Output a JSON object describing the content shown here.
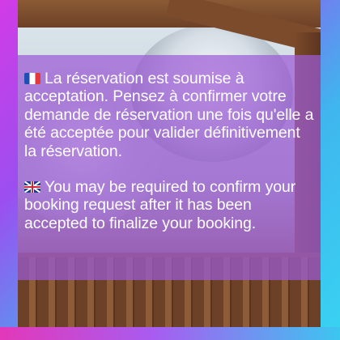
{
  "notice": {
    "french": {
      "flag_icon": "france-flag-icon",
      "text": "La réservation est soumise à acceptation. Pensez à confirmer votre demande de réservation une fois qu'elle a été acceptée pour valider définitivement la réservation."
    },
    "english": {
      "flag_icon": "uk-flag-icon",
      "text": "You may be required to confirm your booking request after it has been accepted to finalize your booking."
    }
  },
  "colors": {
    "overlay": "#9c5cd6",
    "frame_gradient_start": "#d23be6",
    "frame_gradient_end": "#38d3f2",
    "text": "#ffffff"
  }
}
